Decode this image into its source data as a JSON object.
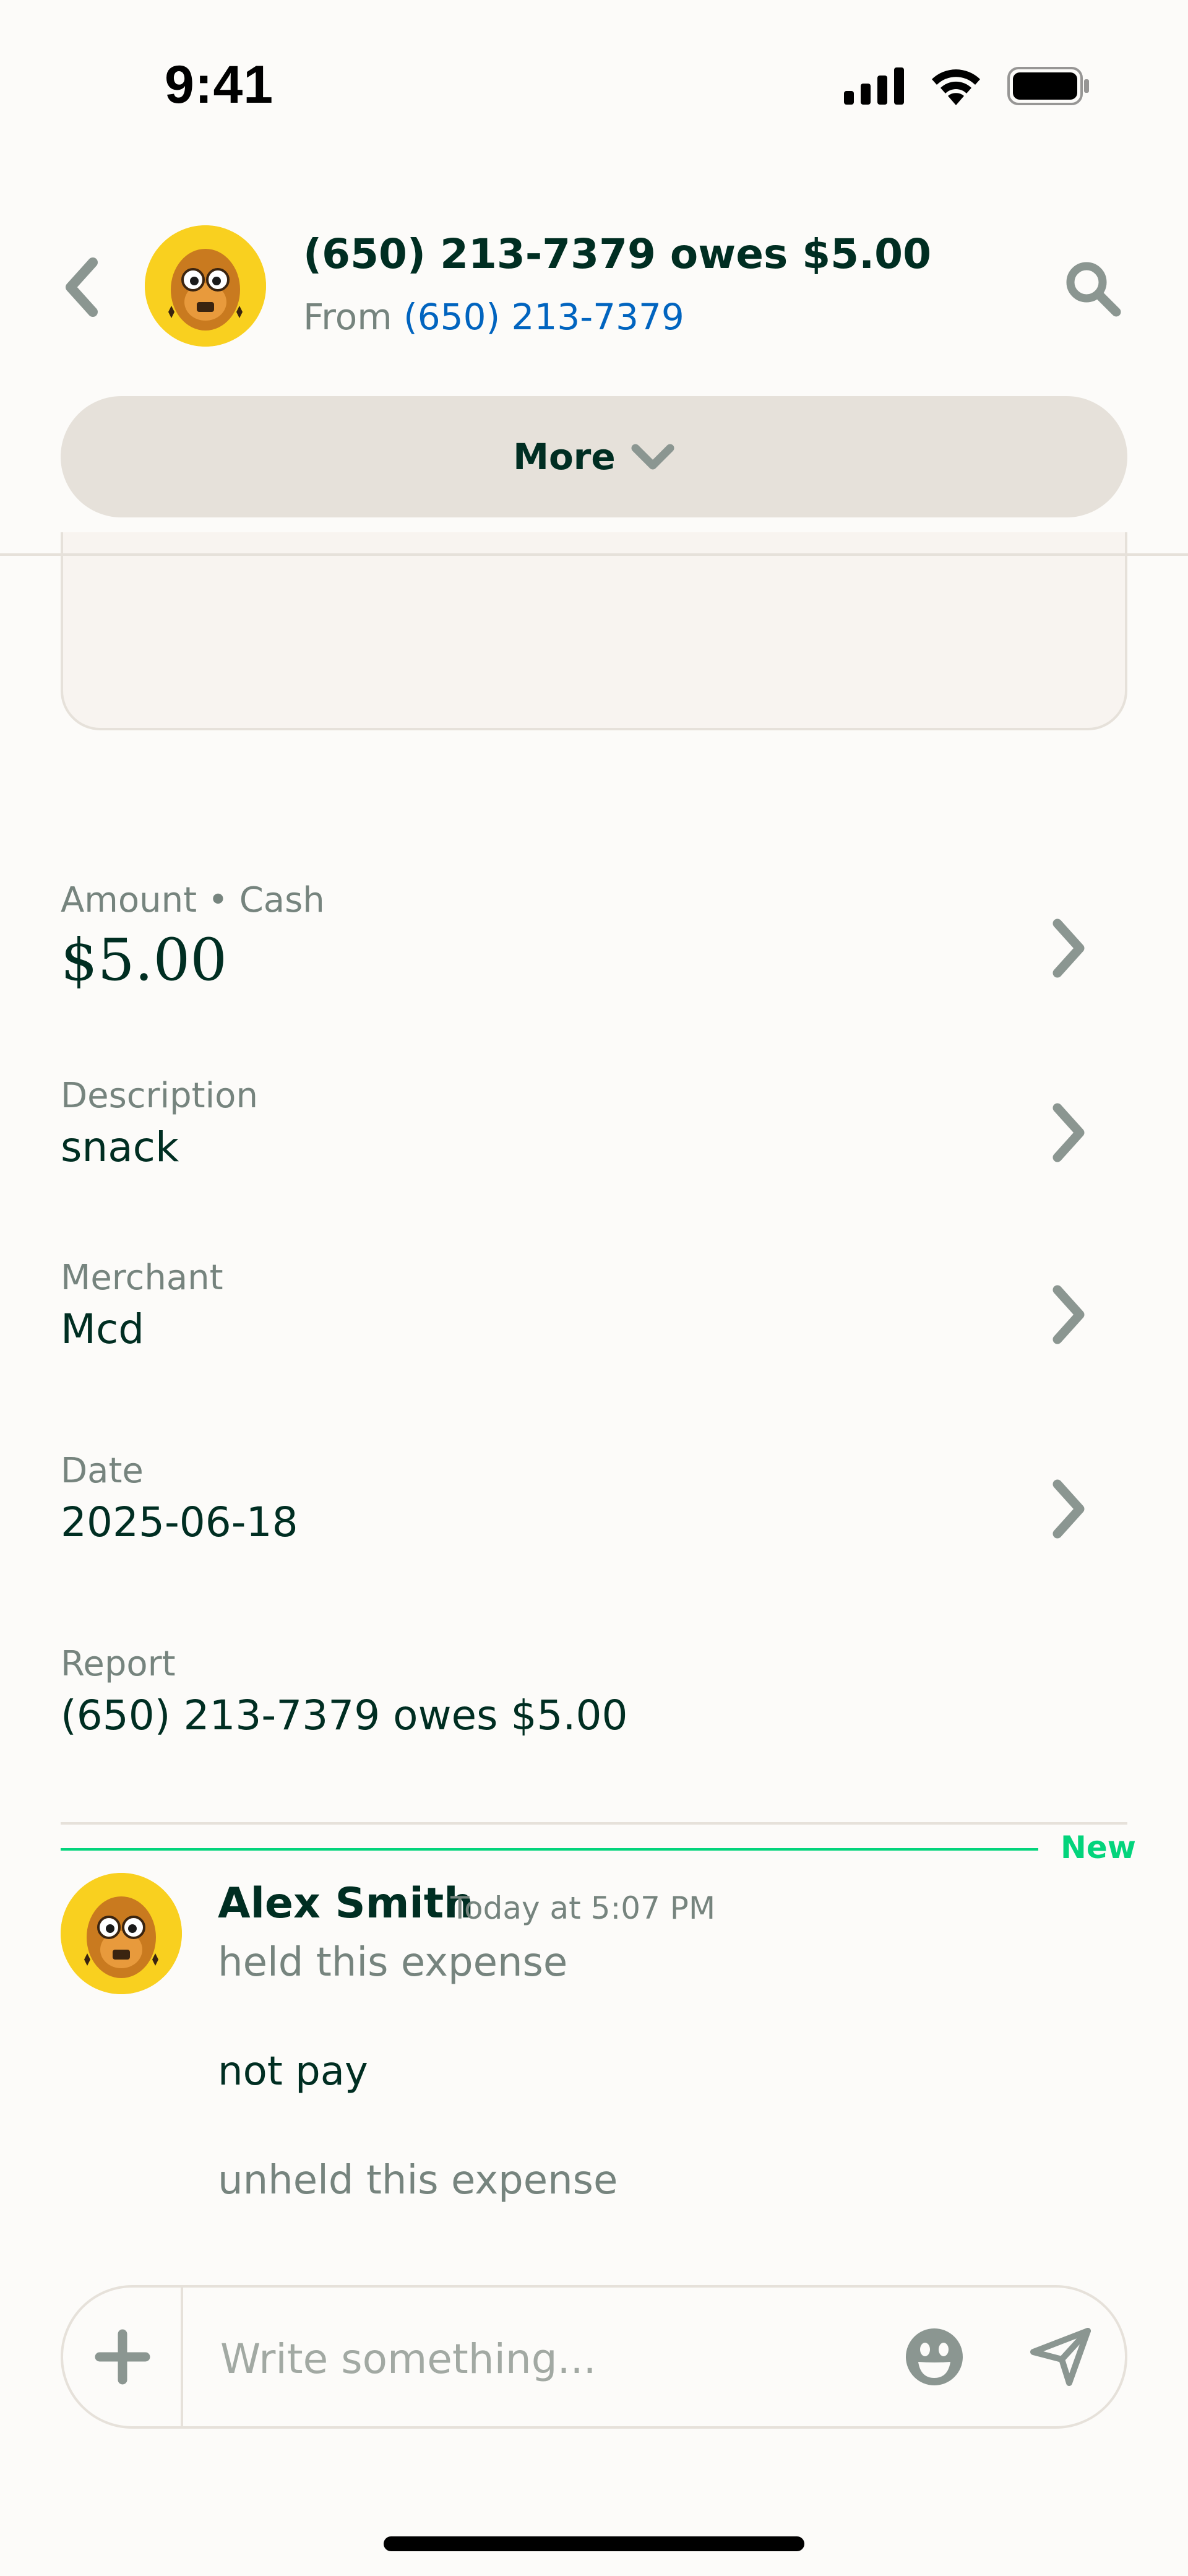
{
  "status_bar": {
    "time": "9:41",
    "icons": [
      "signal-icon",
      "wifi-icon",
      "battery-icon"
    ]
  },
  "header": {
    "title": "(650) 213-7379 owes $5.00",
    "subtitle_prefix": "From",
    "subtitle_link": "(650) 213-7379",
    "more_label": "More",
    "icons": [
      "back-chevron-icon",
      "search-icon",
      "chevron-down-icon"
    ]
  },
  "fields": {
    "amount": {
      "label": "Amount • Cash",
      "value": "$5.00"
    },
    "description": {
      "label": "Description",
      "value": "snack"
    },
    "merchant": {
      "label": "Merchant",
      "value": "Mcd"
    },
    "date": {
      "label": "Date",
      "value": "2025-06-18"
    },
    "report": {
      "label": "Report",
      "value": "(650) 213-7379 owes $5.00"
    }
  },
  "new_marker": "New",
  "message": {
    "author": "Alex Smith",
    "timestamp": "Today at 5:07 PM",
    "lines": [
      "held this expense",
      "not pay",
      "unheld this expense"
    ]
  },
  "composer": {
    "placeholder": "Write something...",
    "icons": [
      "plus-icon",
      "emoji-icon",
      "send-icon"
    ]
  },
  "colors": {
    "background": "#FCFBF9",
    "text": "#002E22",
    "muted": "#76847E",
    "link": "#0164BF",
    "accent_green": "#03D47C",
    "avatar_bg": "#F9D01F",
    "button_bg": "#E6E1DA"
  }
}
